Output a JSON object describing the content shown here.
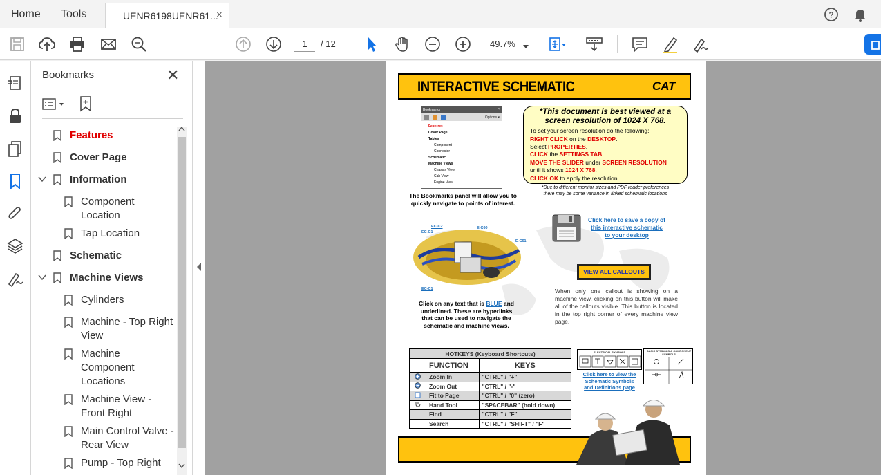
{
  "tabs": {
    "home": "Home",
    "tools": "Tools",
    "document": "UENR6198UENR61...",
    "close": "×"
  },
  "toolbar": {
    "page_current": "1",
    "page_total": "/ 12",
    "zoom": "49.7%"
  },
  "bookmarks": {
    "title": "Bookmarks",
    "items": [
      {
        "label": "Features"
      },
      {
        "label": "Cover Page"
      },
      {
        "label": "Information"
      },
      {
        "label": "Component Location"
      },
      {
        "label": "Tap Location"
      },
      {
        "label": "Schematic"
      },
      {
        "label": "Machine Views"
      },
      {
        "label": "Cylinders"
      },
      {
        "label": "Machine - Top Right View"
      },
      {
        "label": "Machine Component Locations"
      },
      {
        "label": "Machine View - Front Right"
      },
      {
        "label": "Main Control Valve - Rear View"
      },
      {
        "label": "Pump - Top Right"
      }
    ]
  },
  "page": {
    "banner_title": "INTERACTIVE SCHEMATIC",
    "brand": "CAT",
    "mini_panel": {
      "title": "Bookmarks",
      "options": "Options ▾",
      "items": [
        "Features",
        "Cover Page",
        "Tables",
        "Component",
        "Connector",
        "Schematic",
        "Machine Views",
        "Chassis View",
        "Cab View",
        "Engine View"
      ]
    },
    "notice": {
      "heading1": "*This document is best viewed at a",
      "heading2": "screen resolution of 1024 X 768.",
      "line1": "To set your screen resolution do the following:",
      "s1a": "RIGHT CLICK",
      "s1b": " on the ",
      "s1c": "DESKTOP",
      "s1d": ".",
      "s2a": "Select ",
      "s2b": "PROPERTIES",
      "s2c": ".",
      "s3a": "CLICK",
      "s3b": " the ",
      "s3c": "SETTINGS TAB",
      "s3d": ".",
      "s4a": "MOVE THE SLIDER",
      "s4b": " under ",
      "s4c": "SCREEN RESOLUTION",
      "s5a": "until it shows ",
      "s5b": "1024 X 768",
      "s5c": ".",
      "s6a": "CLICK OK",
      "s6b": " to apply the resolution."
    },
    "notice_footnote1": "*Due to different monitor sizes and PDF reader preferences",
    "notice_footnote2": "there may be some variance in linked schematic locations",
    "bookmarks_caption1": "The Bookmarks panel will allow you to",
    "bookmarks_caption2": "quickly navigate to points of interest.",
    "machine_labels": [
      "EC-C2",
      "EC-C1",
      "E-C60",
      "E-C61",
      "EC-C1"
    ],
    "save_link1": "Click here to save a copy of",
    "save_link2": "this interactive schematic",
    "save_link3": "to your desktop",
    "callouts_button": "VIEW ALL CALLOUTS",
    "callout_text": "When only one callout is showing on a machine view, clicking on this button will make all of the callouts visible. This button is located in the top right corner of every machine view page.",
    "blue_text_a": "Click on any text that is ",
    "blue_text_b": "BLUE",
    "blue_text_c": " and",
    "blue_text_2": "underlined. These are hyperlinks",
    "blue_text_3": "that can be used to navigate the",
    "blue_text_4": "schematic and machine views.",
    "hotkeys": {
      "caption": "HOTKEYS (Keyboard Shortcuts)",
      "col_function": "FUNCTION",
      "col_keys": "KEYS",
      "rows": [
        {
          "function": "Zoom In",
          "keys": "\"CTRL\" / \"+\""
        },
        {
          "function": "Zoom Out",
          "keys": "\"CTRL\" / \"-\""
        },
        {
          "function": "Fit to Page",
          "keys": "\"CTRL\" / \"0\" (zero)"
        },
        {
          "function": "Hand Tool",
          "keys": "\"SPACEBAR\" (hold down)"
        },
        {
          "function": "Find",
          "keys": "\"CTRL\" / \"F\""
        },
        {
          "function": "Search",
          "keys": "\"CTRL\" / \"SHIFT\" / \"F\""
        }
      ]
    },
    "symbols_title1": "ELECTRICAL SYMBOLS",
    "symbols_title2": "BASIC SYMBOLS & COMPONENT SYMBOLS",
    "symbols_link1": "Click here to view the",
    "symbols_link2": "Schematic Symbols",
    "symbols_link3": "and Definitions page"
  },
  "colors": {
    "cat_yellow": "#ffc20e",
    "accent_blue": "#1473e6",
    "link_blue": "#1a6ebc",
    "alert_red": "#e00000"
  }
}
